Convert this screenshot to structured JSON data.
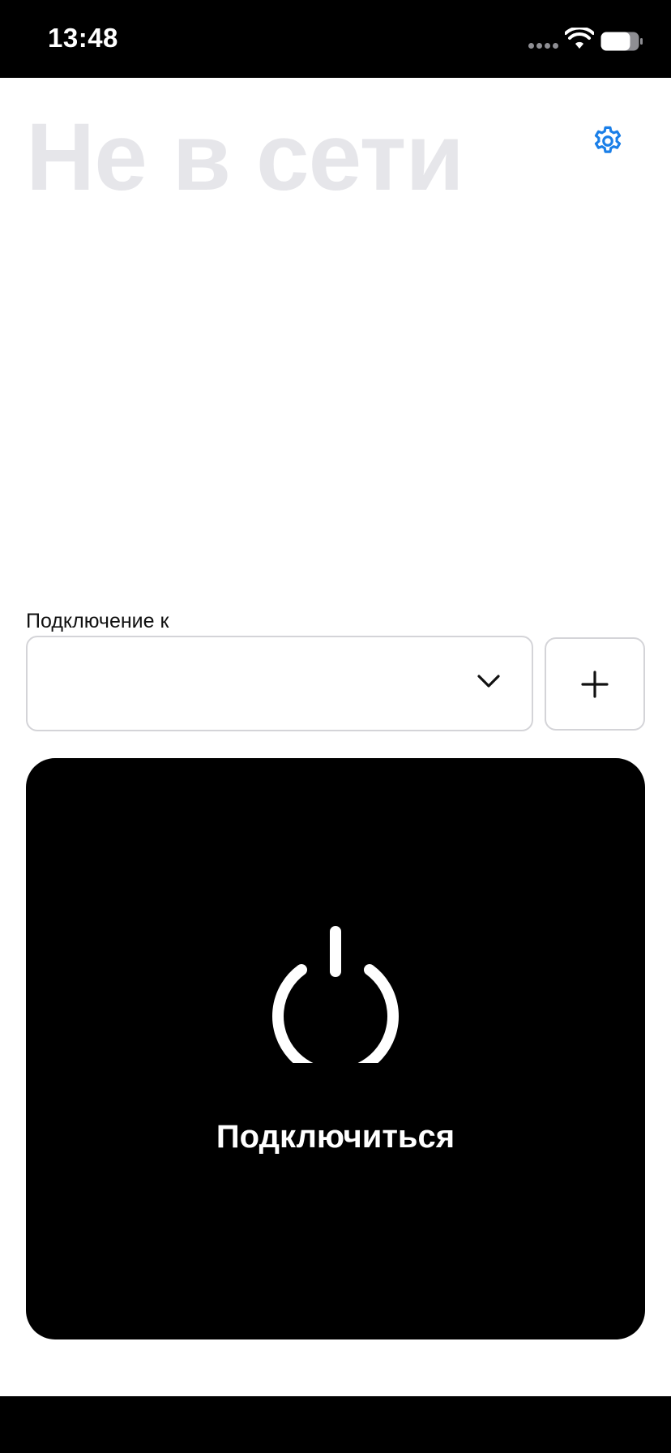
{
  "status_bar": {
    "time": "13:48",
    "wifi_icon": "wifi-icon",
    "battery_icon": "battery-icon",
    "signal_icon": "signal-dots-icon"
  },
  "header": {
    "title": "Не в сети",
    "settings_icon": "gear-icon"
  },
  "connection": {
    "label": "Подключение к",
    "selected_server": "",
    "dropdown_icon": "chevron-down-icon",
    "add_icon": "plus-icon"
  },
  "connect_button": {
    "label": "Подключиться",
    "icon": "power-icon"
  },
  "colors": {
    "accent": "#1a7fe8",
    "title_gray": "#e6e6ea",
    "card_bg": "#000000",
    "border": "#d4d4d8"
  }
}
